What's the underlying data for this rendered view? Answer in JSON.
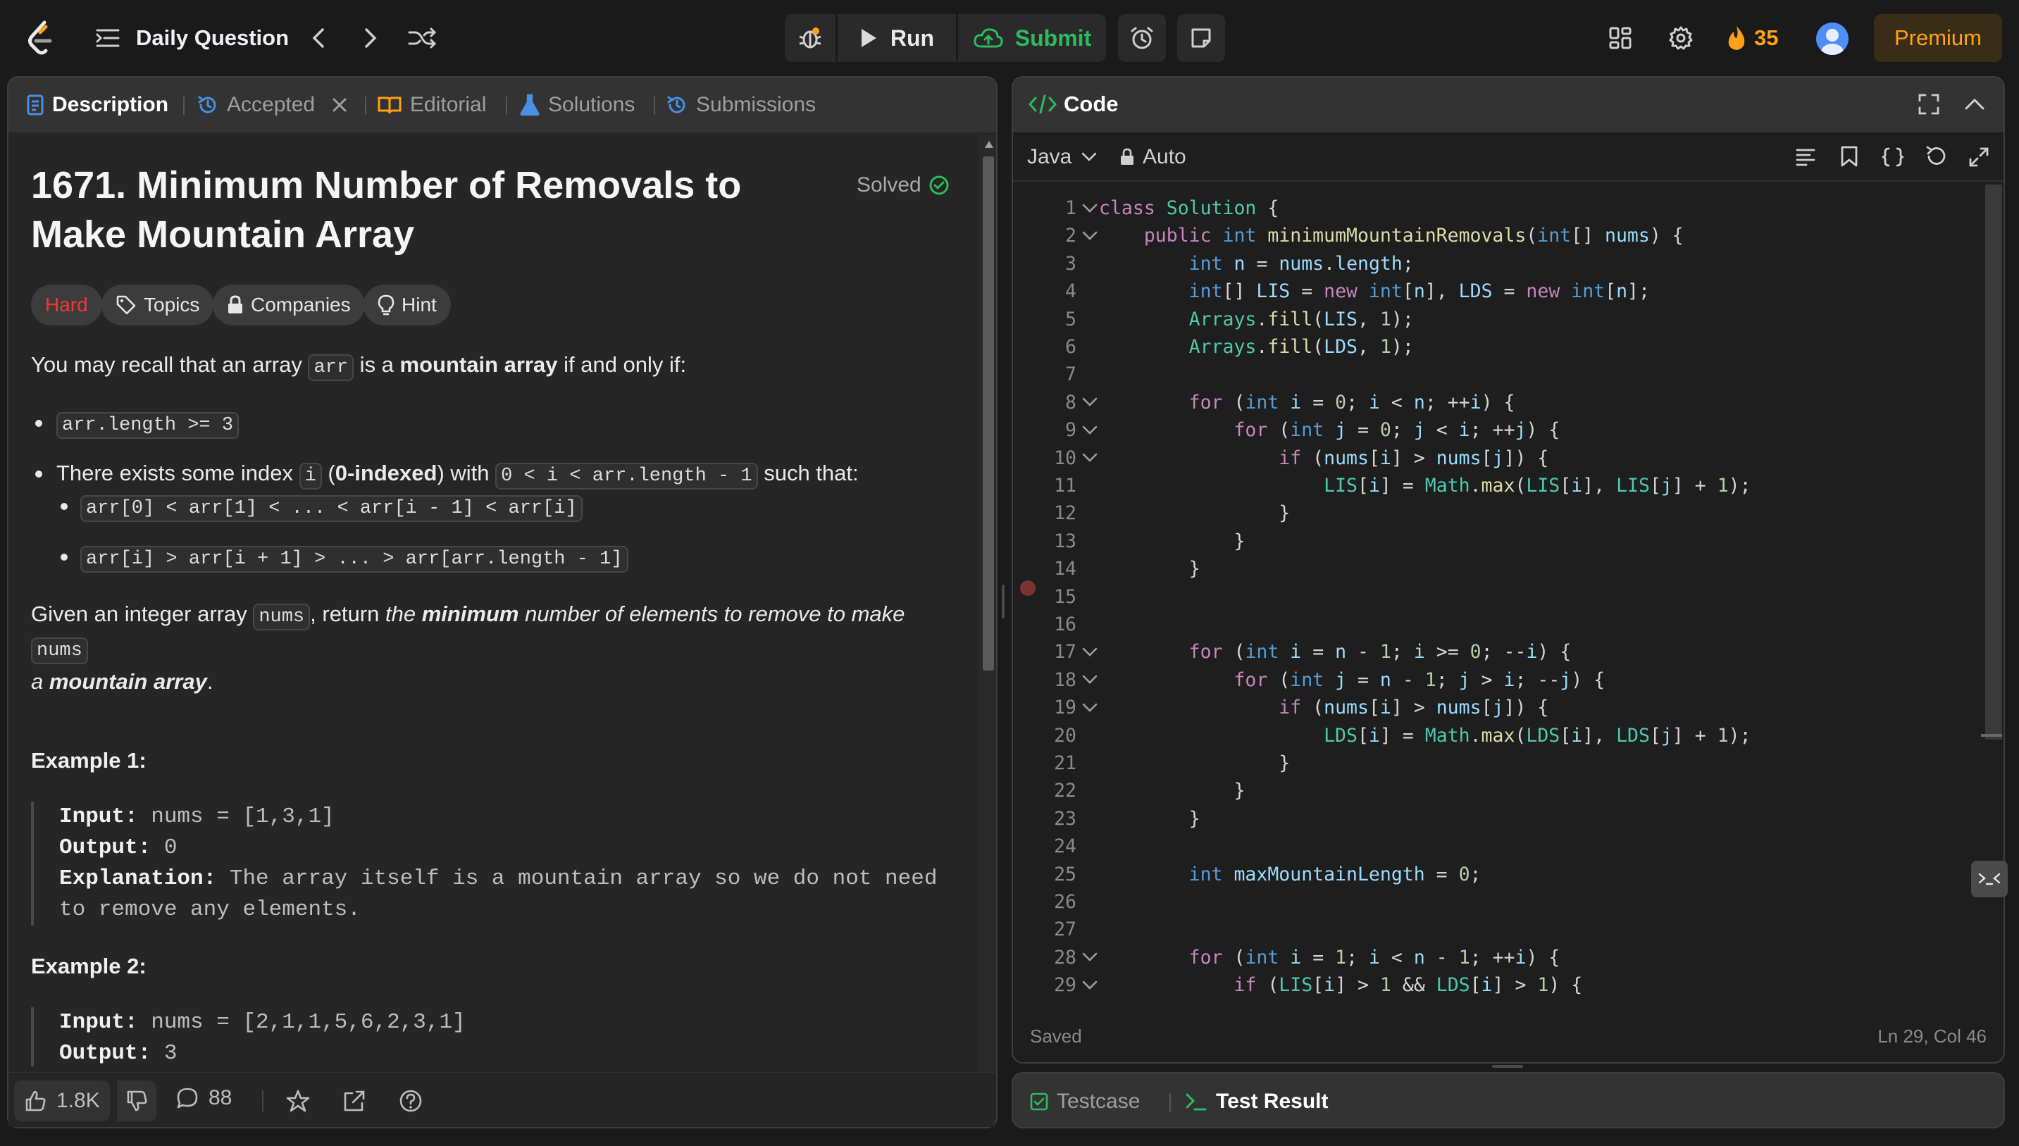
{
  "topbar": {
    "title": "Daily Question",
    "run_label": "Run",
    "submit_label": "Submit",
    "streak_count": "35",
    "premium_label": "Premium"
  },
  "left_tabs": {
    "description": "Description",
    "accepted": "Accepted",
    "editorial": "Editorial",
    "solutions": "Solutions",
    "submissions": "Submissions"
  },
  "problem": {
    "title": "1671. Minimum Number of Removals to Make Mountain Array",
    "status": "Solved",
    "difficulty": "Hard",
    "tags": [
      "Topics",
      "Companies",
      "Hint"
    ],
    "intro_a": "You may recall that an array ",
    "intro_code": "arr",
    "intro_b": " is a ",
    "intro_bold": "mountain array",
    "intro_c": " if and only if:",
    "cond1_code": "arr.length >= 3",
    "cond2_a": "There exists some index ",
    "cond2_code_i": "i",
    "cond2_b": " (",
    "cond2_bold": "0-indexed",
    "cond2_c": ") with ",
    "cond2_code_range": "0 < i < arr.length - 1",
    "cond2_d": " such that:",
    "sub1_code": "arr[0] < arr[1] < ... < arr[i - 1] < arr[i]",
    "sub2_code": "arr[i] > arr[i + 1] > ... > arr[arr.length - 1]",
    "task_a": "Given an integer array ",
    "task_code": "nums",
    "task_b": ", return ",
    "task_i1": "the ",
    "task_bi": "minimum",
    "task_i2": " number of elements to remove to make ",
    "task_code2": "nums",
    "task_i3": "a ",
    "task_bi2": "mountain array",
    "task_end": ".",
    "examples": [
      {
        "heading": "Example 1:",
        "input_label": "Input:",
        "input": " nums = [1,3,1]",
        "output_label": "Output:",
        "output": " 0",
        "explanation_label": "Explanation:",
        "explanation_1": " The array itself is a mountain array so we do not need",
        "explanation_2": "to remove any elements."
      },
      {
        "heading": "Example 2:",
        "input_label": "Input:",
        "input": " nums = [2,1,1,5,6,2,3,1]",
        "output_label": "Output:",
        "output": " 3"
      }
    ]
  },
  "footer": {
    "likes": "1.8K",
    "comments": "88"
  },
  "code_panel": {
    "title": "Code",
    "language": "Java",
    "mode": "Auto",
    "status": "Saved",
    "cursor": "Ln 29, Col 46"
  },
  "code_lines": [
    {
      "n": "1",
      "fold": true,
      "t": [
        [
          "kw",
          "class "
        ],
        [
          "ob",
          "Solution"
        ],
        [
          "",
          " {"
        ]
      ]
    },
    {
      "n": "2",
      "fold": true,
      "t": [
        [
          "",
          "    "
        ],
        [
          "kw",
          "public "
        ],
        [
          "ty",
          "int "
        ],
        [
          "fn",
          "minimumMountainRemovals"
        ],
        [
          "",
          "("
        ],
        [
          "ty",
          "int"
        ],
        [
          "",
          "[] "
        ],
        [
          "vr",
          "nums"
        ],
        [
          "",
          ") {"
        ]
      ]
    },
    {
      "n": "3",
      "fold": false,
      "t": [
        [
          "",
          "        "
        ],
        [
          "ty",
          "int "
        ],
        [
          "vr",
          "n"
        ],
        [
          "",
          " = "
        ],
        [
          "vr",
          "nums"
        ],
        [
          "",
          "."
        ],
        [
          "vr",
          "length"
        ],
        [
          "",
          ";"
        ]
      ]
    },
    {
      "n": "4",
      "fold": false,
      "t": [
        [
          "",
          "        "
        ],
        [
          "ty",
          "int"
        ],
        [
          "",
          "[] "
        ],
        [
          "vr",
          "LIS"
        ],
        [
          "",
          " = "
        ],
        [
          "kw",
          "new "
        ],
        [
          "ty",
          "int"
        ],
        [
          "",
          "["
        ],
        [
          "vr",
          "n"
        ],
        [
          "",
          "], "
        ],
        [
          "vr",
          "LDS"
        ],
        [
          "",
          " = "
        ],
        [
          "kw",
          "new "
        ],
        [
          "ty",
          "int"
        ],
        [
          "",
          "["
        ],
        [
          "vr",
          "n"
        ],
        [
          "",
          "];"
        ]
      ]
    },
    {
      "n": "5",
      "fold": false,
      "t": [
        [
          "",
          "        "
        ],
        [
          "ob",
          "Arrays"
        ],
        [
          "",
          "."
        ],
        [
          "fn",
          "fill"
        ],
        [
          "",
          "("
        ],
        [
          "vr",
          "LIS"
        ],
        [
          "",
          ", "
        ],
        [
          "nm",
          "1"
        ],
        [
          "",
          ");"
        ]
      ]
    },
    {
      "n": "6",
      "fold": false,
      "t": [
        [
          "",
          "        "
        ],
        [
          "ob",
          "Arrays"
        ],
        [
          "",
          "."
        ],
        [
          "fn",
          "fill"
        ],
        [
          "",
          "("
        ],
        [
          "vr",
          "LDS"
        ],
        [
          "",
          ", "
        ],
        [
          "nm",
          "1"
        ],
        [
          "",
          ");"
        ]
      ]
    },
    {
      "n": "7",
      "fold": false,
      "t": [
        [
          "",
          ""
        ]
      ]
    },
    {
      "n": "8",
      "fold": true,
      "t": [
        [
          "",
          "        "
        ],
        [
          "kw",
          "for "
        ],
        [
          "",
          "("
        ],
        [
          "ty",
          "int "
        ],
        [
          "vr",
          "i"
        ],
        [
          "",
          " = "
        ],
        [
          "nm",
          "0"
        ],
        [
          "",
          "; "
        ],
        [
          "vr",
          "i"
        ],
        [
          "",
          " < "
        ],
        [
          "vr",
          "n"
        ],
        [
          "",
          "; ++"
        ],
        [
          "vr",
          "i"
        ],
        [
          "",
          ") {"
        ]
      ]
    },
    {
      "n": "9",
      "fold": true,
      "t": [
        [
          "",
          "            "
        ],
        [
          "kw",
          "for "
        ],
        [
          "",
          "("
        ],
        [
          "ty",
          "int "
        ],
        [
          "vr",
          "j"
        ],
        [
          "",
          " = "
        ],
        [
          "nm",
          "0"
        ],
        [
          "",
          "; "
        ],
        [
          "vr",
          "j"
        ],
        [
          "",
          " < "
        ],
        [
          "vr",
          "i"
        ],
        [
          "",
          "; ++"
        ],
        [
          "vr",
          "j"
        ],
        [
          "",
          ") {"
        ]
      ]
    },
    {
      "n": "10",
      "fold": true,
      "t": [
        [
          "",
          "                "
        ],
        [
          "kw",
          "if "
        ],
        [
          "",
          "("
        ],
        [
          "vr",
          "nums"
        ],
        [
          "",
          "["
        ],
        [
          "vr",
          "i"
        ],
        [
          "",
          "] > "
        ],
        [
          "vr",
          "nums"
        ],
        [
          "",
          "["
        ],
        [
          "vr",
          "j"
        ],
        [
          "",
          "]) {"
        ]
      ]
    },
    {
      "n": "11",
      "fold": false,
      "t": [
        [
          "",
          "                    "
        ],
        [
          "ob",
          "LIS"
        ],
        [
          "",
          "["
        ],
        [
          "vr",
          "i"
        ],
        [
          "",
          "] = "
        ],
        [
          "ob",
          "Math"
        ],
        [
          "",
          "."
        ],
        [
          "fn",
          "max"
        ],
        [
          "",
          "("
        ],
        [
          "ob",
          "LIS"
        ],
        [
          "",
          "["
        ],
        [
          "vr",
          "i"
        ],
        [
          "",
          "], "
        ],
        [
          "ob",
          "LIS"
        ],
        [
          "",
          "["
        ],
        [
          "vr",
          "j"
        ],
        [
          "",
          "] + "
        ],
        [
          "nm",
          "1"
        ],
        [
          "",
          ");"
        ]
      ]
    },
    {
      "n": "12",
      "fold": false,
      "t": [
        [
          "",
          "                }"
        ]
      ]
    },
    {
      "n": "13",
      "fold": false,
      "t": [
        [
          "",
          "            }"
        ]
      ]
    },
    {
      "n": "14",
      "fold": false,
      "t": [
        [
          "",
          "        }"
        ]
      ]
    },
    {
      "n": "15",
      "fold": false,
      "t": [
        [
          "",
          ""
        ]
      ]
    },
    {
      "n": "16",
      "fold": false,
      "t": [
        [
          "",
          ""
        ]
      ]
    },
    {
      "n": "17",
      "fold": true,
      "t": [
        [
          "",
          "        "
        ],
        [
          "kw",
          "for "
        ],
        [
          "",
          "("
        ],
        [
          "ty",
          "int "
        ],
        [
          "vr",
          "i"
        ],
        [
          "",
          " = "
        ],
        [
          "vr",
          "n"
        ],
        [
          "",
          " - "
        ],
        [
          "nm",
          "1"
        ],
        [
          "",
          "; "
        ],
        [
          "vr",
          "i"
        ],
        [
          "",
          " >= "
        ],
        [
          "nm",
          "0"
        ],
        [
          "",
          "; --"
        ],
        [
          "vr",
          "i"
        ],
        [
          "",
          ") {"
        ]
      ]
    },
    {
      "n": "18",
      "fold": true,
      "t": [
        [
          "",
          "            "
        ],
        [
          "kw",
          "for "
        ],
        [
          "",
          "("
        ],
        [
          "ty",
          "int "
        ],
        [
          "vr",
          "j"
        ],
        [
          "",
          " = "
        ],
        [
          "vr",
          "n"
        ],
        [
          "",
          " - "
        ],
        [
          "nm",
          "1"
        ],
        [
          "",
          "; "
        ],
        [
          "vr",
          "j"
        ],
        [
          "",
          " > "
        ],
        [
          "vr",
          "i"
        ],
        [
          "",
          "; --"
        ],
        [
          "vr",
          "j"
        ],
        [
          "",
          ") {"
        ]
      ]
    },
    {
      "n": "19",
      "fold": true,
      "t": [
        [
          "",
          "                "
        ],
        [
          "kw",
          "if "
        ],
        [
          "",
          "("
        ],
        [
          "vr",
          "nums"
        ],
        [
          "",
          "["
        ],
        [
          "vr",
          "i"
        ],
        [
          "",
          "] > "
        ],
        [
          "vr",
          "nums"
        ],
        [
          "",
          "["
        ],
        [
          "vr",
          "j"
        ],
        [
          "",
          "]) {"
        ]
      ]
    },
    {
      "n": "20",
      "fold": false,
      "t": [
        [
          "",
          "                    "
        ],
        [
          "ob",
          "LDS"
        ],
        [
          "",
          "["
        ],
        [
          "vr",
          "i"
        ],
        [
          "",
          "] = "
        ],
        [
          "ob",
          "Math"
        ],
        [
          "",
          "."
        ],
        [
          "fn",
          "max"
        ],
        [
          "",
          "("
        ],
        [
          "ob",
          "LDS"
        ],
        [
          "",
          "["
        ],
        [
          "vr",
          "i"
        ],
        [
          "",
          "], "
        ],
        [
          "ob",
          "LDS"
        ],
        [
          "",
          "["
        ],
        [
          "vr",
          "j"
        ],
        [
          "",
          "] + "
        ],
        [
          "nm",
          "1"
        ],
        [
          "",
          ");"
        ]
      ]
    },
    {
      "n": "21",
      "fold": false,
      "t": [
        [
          "",
          "                }"
        ]
      ]
    },
    {
      "n": "22",
      "fold": false,
      "t": [
        [
          "",
          "            }"
        ]
      ]
    },
    {
      "n": "23",
      "fold": false,
      "t": [
        [
          "",
          "        }"
        ]
      ]
    },
    {
      "n": "24",
      "fold": false,
      "t": [
        [
          "",
          ""
        ]
      ]
    },
    {
      "n": "25",
      "fold": false,
      "t": [
        [
          "",
          "        "
        ],
        [
          "ty",
          "int "
        ],
        [
          "vr",
          "maxMountainLength"
        ],
        [
          "",
          " = "
        ],
        [
          "nm",
          "0"
        ],
        [
          "",
          ";"
        ]
      ]
    },
    {
      "n": "26",
      "fold": false,
      "t": [
        [
          "",
          ""
        ]
      ]
    },
    {
      "n": "27",
      "fold": false,
      "t": [
        [
          "",
          ""
        ]
      ]
    },
    {
      "n": "28",
      "fold": true,
      "t": [
        [
          "",
          "        "
        ],
        [
          "kw",
          "for "
        ],
        [
          "",
          "("
        ],
        [
          "ty",
          "int "
        ],
        [
          "vr",
          "i"
        ],
        [
          "",
          " = "
        ],
        [
          "nm",
          "1"
        ],
        [
          "",
          "; "
        ],
        [
          "vr",
          "i"
        ],
        [
          "",
          " < "
        ],
        [
          "vr",
          "n"
        ],
        [
          "",
          " - "
        ],
        [
          "nm",
          "1"
        ],
        [
          "",
          "; ++"
        ],
        [
          "vr",
          "i"
        ],
        [
          "",
          ") {"
        ]
      ]
    },
    {
      "n": "29",
      "fold": true,
      "t": [
        [
          "",
          "            "
        ],
        [
          "kw",
          "if "
        ],
        [
          "",
          "("
        ],
        [
          "ob",
          "LIS"
        ],
        [
          "",
          "["
        ],
        [
          "vr",
          "i"
        ],
        [
          "",
          "] > "
        ],
        [
          "nm",
          "1"
        ],
        [
          "",
          " && "
        ],
        [
          "ob",
          "LDS"
        ],
        [
          "",
          "["
        ],
        [
          "vr",
          "i"
        ],
        [
          "",
          "] > "
        ],
        [
          "nm",
          "1"
        ],
        [
          "",
          ") {"
        ]
      ]
    }
  ],
  "bottom_tabs": {
    "testcase": "Testcase",
    "test_result": "Test Result"
  },
  "colors": {
    "accent_green": "#2cbb5d",
    "hard_red": "#f63636",
    "premium_orange": "#ffa116",
    "tab_blue": "#4a90e2"
  }
}
